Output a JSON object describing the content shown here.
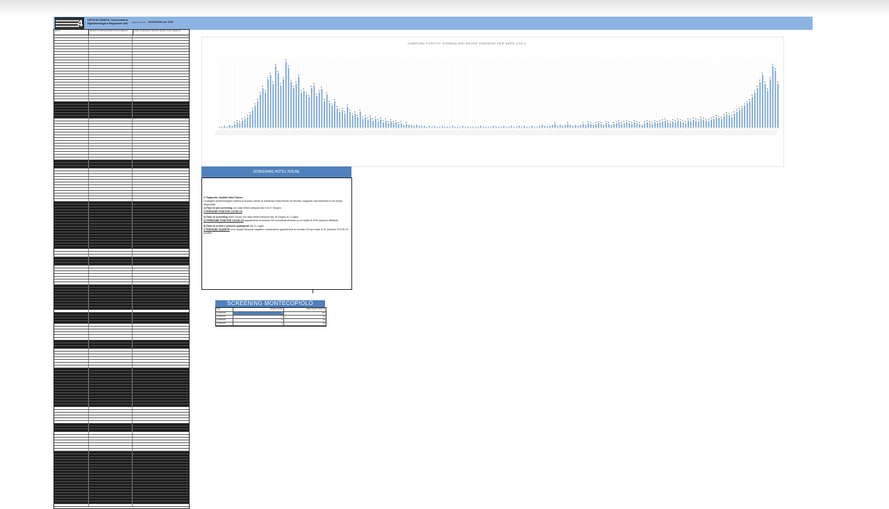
{
  "header": {
    "org_title": "UFFICIO SANITA' Osservatorio Epidemiologico Regionale ASL",
    "update_label": "aggiornamento",
    "update_value": "13/10/2020 ore 9:00",
    "logo_number": "4"
  },
  "table": {
    "columns": [
      "giorni",
      "tamponi positivi giornalieri nuove diagnosi",
      "totale complessivo tamponi positivi nuove diagnosi"
    ]
  },
  "chart": {
    "title": "CAMPIONI POSITIVI GIORNALIERI NUOVE DIAGNOSI PER SARS-COV-2"
  },
  "chart_data": {
    "type": "bar",
    "title": "CAMPIONI POSITIVI GIORNALIERI NUOVE DIAGNOSI PER SARS-COV-2",
    "xlabel": "",
    "ylabel": "",
    "series": [
      {
        "values": [
          1,
          1,
          2,
          1,
          3,
          2,
          4,
          6,
          5,
          8,
          10,
          12,
          15,
          20,
          25,
          30,
          38,
          45,
          40,
          55,
          60,
          50,
          70,
          62,
          48,
          55,
          75,
          68,
          52,
          45,
          50,
          58,
          40,
          42,
          38,
          35,
          45,
          48,
          36,
          40,
          44,
          30,
          38,
          28,
          25,
          30,
          22,
          18,
          20,
          16,
          24,
          18,
          14,
          16,
          12,
          18,
          10,
          12,
          9,
          11,
          8,
          10,
          7,
          9,
          6,
          8,
          5,
          7,
          5,
          6,
          4,
          5,
          3,
          4,
          3,
          3,
          2,
          3,
          2,
          2,
          2,
          1,
          2,
          1,
          2,
          1,
          1,
          2,
          1,
          1,
          1,
          2,
          1,
          1,
          1,
          2,
          1,
          1,
          1,
          1,
          1,
          1,
          2,
          1,
          1,
          1,
          1,
          2,
          1,
          1,
          1,
          2,
          1,
          1,
          2,
          1,
          1,
          2,
          1,
          2,
          1,
          1,
          2,
          1,
          1,
          2,
          3,
          2,
          1,
          2,
          3,
          4,
          2,
          3,
          2,
          3,
          4,
          3,
          2,
          3,
          2,
          3,
          4,
          3,
          5,
          4,
          3,
          4,
          5,
          4,
          3,
          5,
          4,
          3,
          4,
          5,
          6,
          4,
          5,
          6,
          5,
          4,
          6,
          5,
          4,
          3,
          5,
          6,
          5,
          4,
          6,
          5,
          6,
          7,
          8,
          6,
          5,
          7,
          6,
          8,
          7,
          6,
          5,
          8,
          7,
          9,
          8,
          7,
          10,
          9,
          8,
          7,
          9,
          10,
          12,
          11,
          10,
          13,
          15,
          14,
          12,
          16,
          18,
          20,
          22,
          25,
          28,
          30,
          35,
          40,
          45,
          52,
          60,
          50,
          42,
          55,
          70,
          65,
          50
        ]
      }
    ]
  },
  "hotel": {
    "heading": "SCREENING HOTEL HOUSE",
    "report_title": "1° Rapporto risultati Hotel House",
    "intro": "L'indagine epidemiologica relativa al focolaio riferito al residence Hotel House ha rilevato i seguenti casi distribuiti su tre tempi diagnostici:",
    "phase1_label": "1) Fase di pre-screening",
    "phase1_text": " con data referto tamponi dal 9 al 17 Giugno:",
    "phase1_result": "3 PERSONE POSITIVE COVID-19",
    "phase2_label": "2) Fase di screening",
    "phase2_text": " Hotel House con data referto tamponi dal 18 Giugno al 7 Luglio:",
    "phase2_result": "31 PERSONE POSITIVE COVID-19",
    "phase2_tail": " appartenenti al focolaio HH complessivamente su un totale di 1034 tamponi effettuati",
    "phase3_label": "3) Fase di re-test e persone guarigione",
    "phase3_text": " dal 11 Luglio",
    "phase3_result": "2 PERSONE GUARITE",
    "phase3_tail": " (con doppio tampone negativo consecutivo) appartenenti al focolaio HH sul totale di 31 persone COVID-19 positive"
  },
  "monte": {
    "heading": "SCREENING MONTECOPIOLO",
    "headers": [
      "data",
      "tamponi positivi",
      "totale tamponi effettuati"
    ],
    "rows": [
      {
        "date": "10/08/2020",
        "pos": "0",
        "tot": "215"
      },
      {
        "date": "11/08/2020",
        "pos": "1",
        "tot": "48"
      },
      {
        "date": "12/08/2020",
        "pos": "0",
        "tot": "30"
      },
      {
        "date": "13/08/2020",
        "pos": "0",
        "tot": "18"
      }
    ]
  }
}
